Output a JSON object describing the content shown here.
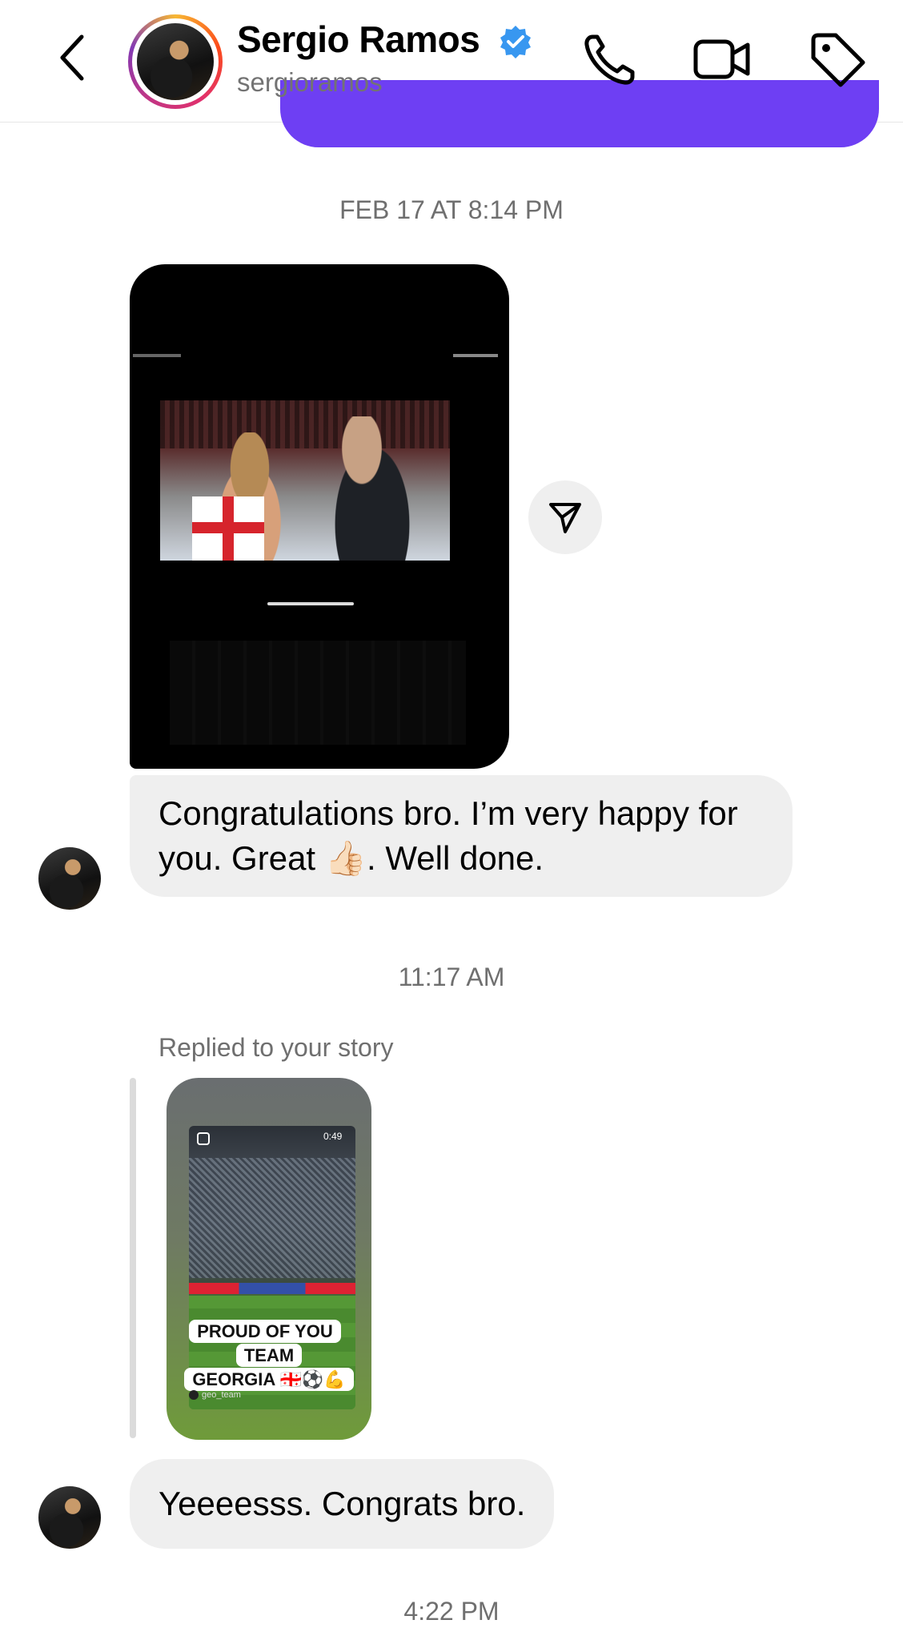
{
  "header": {
    "name": "Sergio Ramos",
    "handle": "sergioramos"
  },
  "thread": {
    "timestamp_1": "FEB 17 AT 8:14 PM",
    "message_1": "Congratulations bro. I’m very happy for you. Great 👍🏻. Well done.",
    "timestamp_2": "11:17 AM",
    "reply_label": "Replied to your story",
    "story": {
      "duration": "0:49",
      "caption_line1": "PROUD OF YOU TEAM",
      "caption_line2": "GEORGIA 🇬🇪⚽💪",
      "account": "geo_team"
    },
    "message_2": "Yeeeesss. Congrats bro.",
    "timestamp_3": "4:22 PM"
  },
  "colors": {
    "accent": "#6e3ff3",
    "verified": "#3897f0",
    "bubble": "#efefef"
  },
  "icons": [
    "back-icon",
    "verified-icon",
    "phone-icon",
    "video-icon",
    "tag-icon",
    "send-icon",
    "reel-icon"
  ]
}
